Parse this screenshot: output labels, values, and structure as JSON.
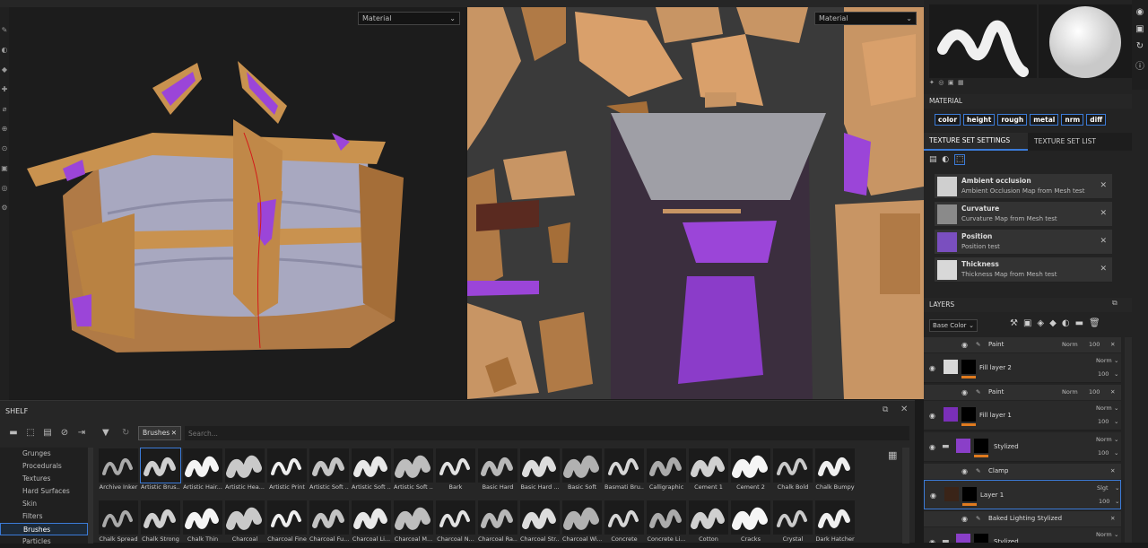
{
  "viewport3d": {
    "mode": "Material"
  },
  "viewport2d": {
    "mode": "Material"
  },
  "material": {
    "title": "MATERIAL",
    "channels": [
      "color",
      "height",
      "rough",
      "metal",
      "nrm",
      "diff"
    ]
  },
  "texture_set": {
    "tabs": [
      "TEXTURE SET SETTINGS",
      "TEXTURE SET LIST"
    ],
    "maps": [
      {
        "title": "Ambient occlusion",
        "subtitle": "Ambient Occlusion Map from Mesh test"
      },
      {
        "title": "Curvature",
        "subtitle": "Curvature Map from Mesh test"
      },
      {
        "title": "Position",
        "subtitle": "Position test"
      },
      {
        "title": "Thickness",
        "subtitle": "Thickness Map from Mesh test"
      }
    ]
  },
  "layers": {
    "title": "LAYERS",
    "channel": "Base Color",
    "items": [
      {
        "kind": "sub",
        "name": "Paint",
        "blend": "Norm",
        "opacity": "100"
      },
      {
        "kind": "layer",
        "name": "Fill layer 2",
        "blend": "Norm",
        "opacity": "100"
      },
      {
        "kind": "sub",
        "name": "Paint",
        "blend": "Norm",
        "opacity": "100"
      },
      {
        "kind": "layer",
        "name": "Fill layer 1",
        "blend": "Norm",
        "opacity": "100"
      },
      {
        "kind": "layer",
        "name": "Stylized",
        "blend": "Norm",
        "opacity": "100"
      },
      {
        "kind": "sub",
        "name": "Clamp",
        "blend": "",
        "opacity": ""
      },
      {
        "kind": "layer",
        "name": "Layer 1",
        "blend": "Slgt",
        "opacity": "100"
      },
      {
        "kind": "sub",
        "name": "Baked Lighting Stylized",
        "blend": "",
        "opacity": ""
      },
      {
        "kind": "layer",
        "name": "Stylized",
        "blend": "Norm",
        "opacity": ""
      }
    ]
  },
  "shelf": {
    "title": "SHELF",
    "filter_chip": "Brushes",
    "search_placeholder": "Search...",
    "categories": [
      "Grunges",
      "Procedurals",
      "Textures",
      "Hard Surfaces",
      "Skin",
      "Filters",
      "Brushes",
      "Particles"
    ],
    "selected_category": "Brushes",
    "brushes_row1": [
      "Archive Inker",
      "Artistic Brus...",
      "Artistic Hair...",
      "Artistic Hea...",
      "Artistic Print",
      "Artistic Soft ...",
      "Artistic Soft ...",
      "Artistic Soft ...",
      "Bark",
      "Basic Hard",
      "Basic Hard ...",
      "Basic Soft",
      "Basmati Bru...",
      "Calligraphic",
      "Cement 1",
      "Cement 2",
      "Chalk Bold",
      "Chalk Bumpy"
    ],
    "brushes_row2": [
      "Chalk Spread",
      "Chalk Strong",
      "Chalk Thin",
      "Charcoal",
      "Charcoal Fine",
      "Charcoal Fu...",
      "Charcoal Li...",
      "Charcoal M...",
      "Charcoal N...",
      "Charcoal Ra...",
      "Charcoal Str...",
      "Charcoal Wi...",
      "Concrete",
      "Concrete Li...",
      "Cotton",
      "Cracks",
      "Crystal",
      "Dark Hatcher"
    ]
  },
  "colors": {
    "accent": "#3b7bd8",
    "orange": "#e07a1e",
    "purple": "#9b45d8"
  }
}
